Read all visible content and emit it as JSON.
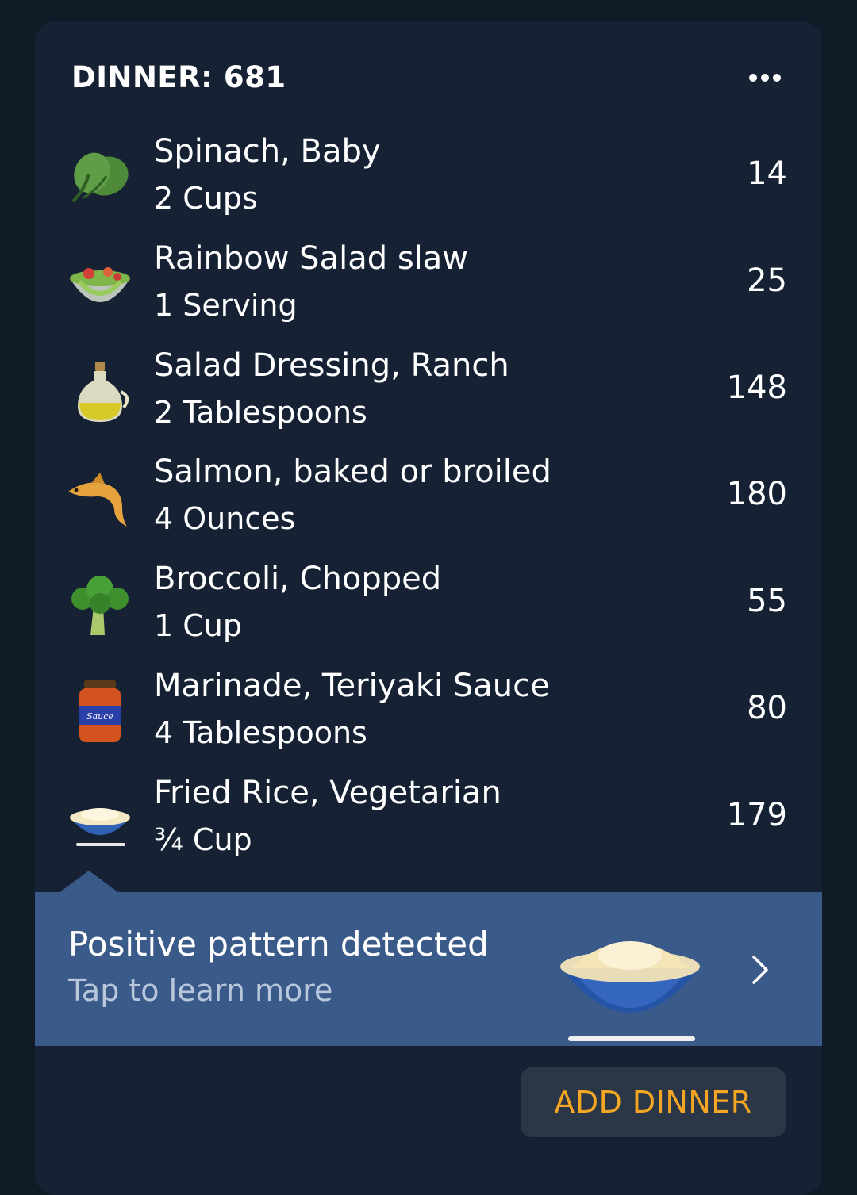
{
  "meal": {
    "title": "DINNER: 681",
    "more_icon": "more-horizontal-icon"
  },
  "items": [
    {
      "name": "Spinach, Baby",
      "quantity": "2 Cups",
      "calories": "14",
      "icon": "spinach-icon"
    },
    {
      "name": "Rainbow Salad slaw",
      "quantity": "1 Serving",
      "calories": "25",
      "icon": "salad-bowl-icon"
    },
    {
      "name": "Salad Dressing, Ranch",
      "quantity": "2 Tablespoons",
      "calories": "148",
      "icon": "oil-bottle-icon"
    },
    {
      "name": "Salmon, baked or broiled",
      "quantity": "4 Ounces",
      "calories": "180",
      "icon": "fish-icon"
    },
    {
      "name": "Broccoli, Chopped",
      "quantity": "1 Cup",
      "calories": "55",
      "icon": "broccoli-icon"
    },
    {
      "name": "Marinade, Teriyaki Sauce",
      "quantity": "4 Tablespoons",
      "calories": "80",
      "icon": "sauce-jar-icon"
    },
    {
      "name": "Fried Rice, Vegetarian",
      "quantity": "¾ Cup",
      "calories": "179",
      "icon": "rice-bowl-icon"
    }
  ],
  "insight": {
    "title": "Positive pattern detected",
    "subtitle": "Tap to learn more",
    "image_icon": "rice-bowl-icon",
    "chevron_icon": "chevron-right-icon"
  },
  "actions": {
    "add_label": "ADD DINNER"
  },
  "colors": {
    "background": "#111a27",
    "card": "#162234",
    "banner": "#3a5a89",
    "accent": "#f5a623",
    "button": "#2b3746"
  }
}
